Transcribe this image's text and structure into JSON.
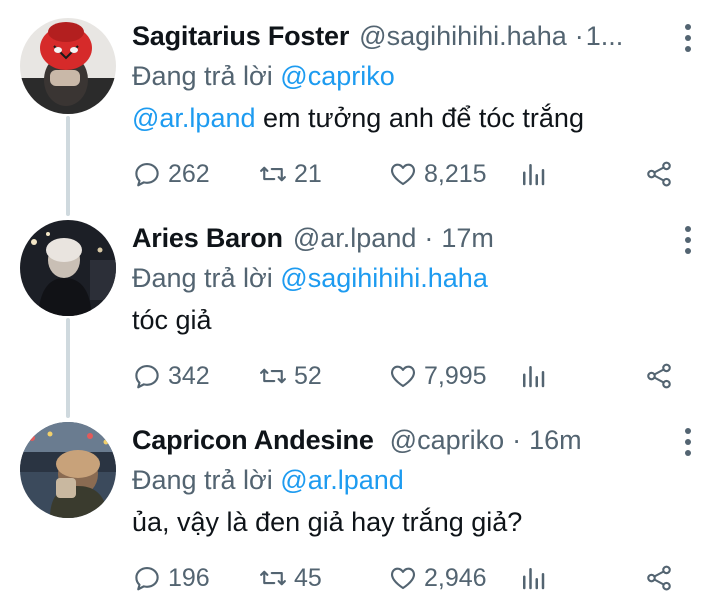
{
  "tweets": [
    {
      "name": "Sagitarius Foster",
      "handle": "@sagihihihi.haha",
      "separator": "·",
      "time": "1...",
      "reply_prefix": "Đang trả lời",
      "reply_to": "@capriko",
      "body_mention": "@ar.lpand",
      "body_text": " em tưởng anh để tóc trắng",
      "replies": "262",
      "retweets": "21",
      "likes": "8,215"
    },
    {
      "name": "Aries Baron",
      "handle": "@ar.lpand",
      "separator": "·",
      "time": "17m",
      "reply_prefix": "Đang trả lời",
      "reply_to": "@sagihihihi.haha",
      "body_mention": "",
      "body_text": "tóc giả",
      "replies": "342",
      "retweets": "52",
      "likes": "7,995"
    },
    {
      "name": "Capricon Andesine",
      "handle": "@capriko",
      "separator": "·",
      "time": "16m",
      "reply_prefix": "Đang trả lời",
      "reply_to": "@ar.lpand",
      "body_mention": "",
      "body_text": "ủa, vậy là đen giả hay trắng giả?",
      "replies": "196",
      "retweets": "45",
      "likes": "2,946"
    }
  ],
  "colors": {
    "accent": "#1d9bf0",
    "secondary_text": "#536471",
    "thread_line": "#cfd9de"
  },
  "icons": [
    "reply-icon",
    "retweet-icon",
    "like-icon",
    "analytics-icon",
    "share-icon",
    "more-icon"
  ]
}
